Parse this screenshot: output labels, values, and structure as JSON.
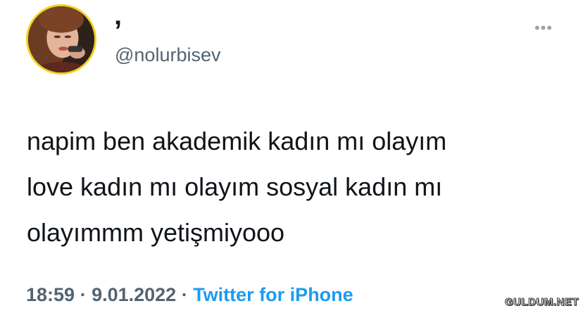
{
  "author": {
    "display_name": "’",
    "handle": "@nolurbisev",
    "avatar_border_color": "#f2d21c"
  },
  "menu": {
    "icon": "more-horizontal-icon",
    "glyph": "•••"
  },
  "tweet": {
    "text": "napim ben akademik kadın mı olayım\nlove kadın mı olayım sosyal kadın mı\nolayımmm yetişmiyooo"
  },
  "meta": {
    "time": "18:59",
    "separator": " · ",
    "date": "9.01.2022",
    "source": "Twitter for iPhone"
  },
  "watermark": {
    "text": "GULDUM.NET"
  },
  "colors": {
    "text": "#0f1419",
    "secondary": "#536471",
    "link": "#1d9bf0"
  }
}
